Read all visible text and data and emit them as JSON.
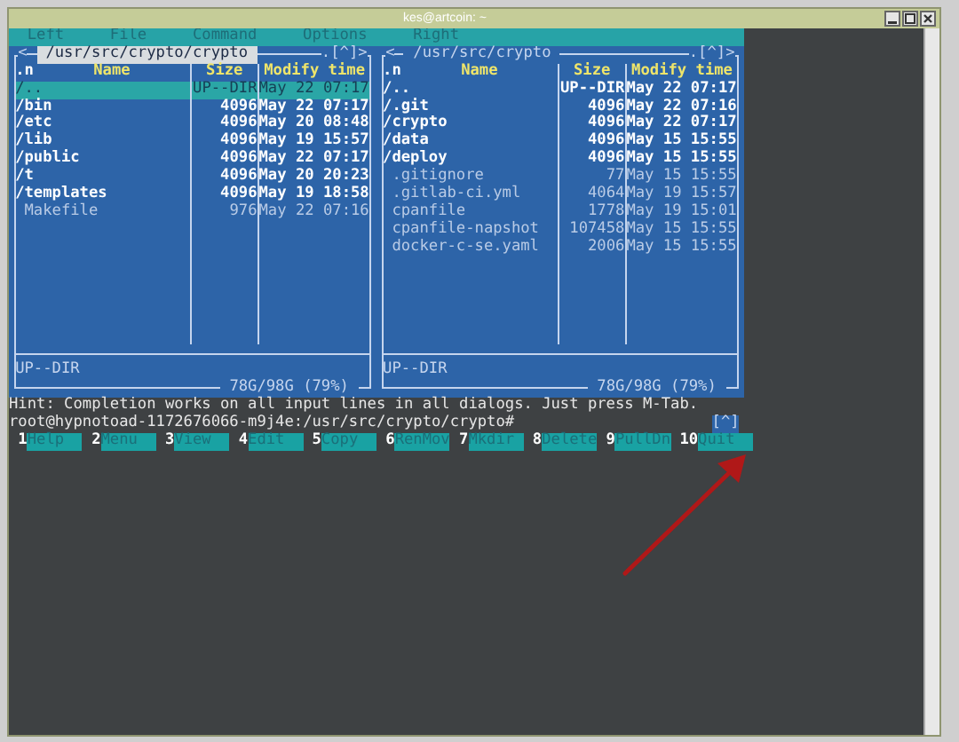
{
  "window": {
    "title": "kes@artcoin: ~"
  },
  "menu": [
    {
      "label": "Left"
    },
    {
      "label": "File"
    },
    {
      "label": "Command"
    },
    {
      "label": "Options"
    },
    {
      "label": "Right"
    }
  ],
  "panels": [
    {
      "active": true,
      "history": "<",
      "path": "/usr/src/crypto/crypto",
      "controls": ".[^]>",
      "columns": {
        "sort": ".n",
        "name": "Name",
        "size": "Size",
        "modified": "Modify time"
      },
      "rows": [
        {
          "name": "/..",
          "size": "UP--DIR",
          "modified": "May 22 07:17",
          "kind": "dir",
          "selected": true
        },
        {
          "name": "/bin",
          "size": "4096",
          "modified": "May 22 07:17",
          "kind": "dir",
          "selected": false
        },
        {
          "name": "/etc",
          "size": "4096",
          "modified": "May 20 08:48",
          "kind": "dir",
          "selected": false
        },
        {
          "name": "/lib",
          "size": "4096",
          "modified": "May 19 15:57",
          "kind": "dir",
          "selected": false
        },
        {
          "name": "/public",
          "size": "4096",
          "modified": "May 22 07:17",
          "kind": "dir",
          "selected": false
        },
        {
          "name": "/t",
          "size": "4096",
          "modified": "May 20 20:23",
          "kind": "dir",
          "selected": false
        },
        {
          "name": "/templates",
          "size": "4096",
          "modified": "May 19 18:58",
          "kind": "dir",
          "selected": false
        },
        {
          "name": "Makefile",
          "size": "976",
          "modified": "May 22 07:16",
          "kind": "file",
          "selected": false
        }
      ],
      "status": "UP--DIR",
      "disk": "78G/98G (79%)"
    },
    {
      "active": false,
      "history": "<",
      "path": "/usr/src/crypto",
      "controls": ".[^]>",
      "columns": {
        "sort": ".n",
        "name": "Name",
        "size": "Size",
        "modified": "Modify time"
      },
      "rows": [
        {
          "name": "/..",
          "size": "UP--DIR",
          "modified": "May 22 07:17",
          "kind": "dir",
          "selected": false
        },
        {
          "name": "/.git",
          "size": "4096",
          "modified": "May 22 07:16",
          "kind": "dir",
          "selected": false
        },
        {
          "name": "/crypto",
          "size": "4096",
          "modified": "May 22 07:17",
          "kind": "dir",
          "selected": false
        },
        {
          "name": "/data",
          "size": "4096",
          "modified": "May 15 15:55",
          "kind": "dir",
          "selected": false
        },
        {
          "name": "/deploy",
          "size": "4096",
          "modified": "May 15 15:55",
          "kind": "dir",
          "selected": false
        },
        {
          "name": ".gitignore",
          "size": "77",
          "modified": "May 15 15:55",
          "kind": "file",
          "selected": false
        },
        {
          "name": ".gitlab-ci.yml",
          "size": "4064",
          "modified": "May 19 15:57",
          "kind": "file",
          "selected": false
        },
        {
          "name": "cpanfile",
          "size": "1778",
          "modified": "May 19 15:01",
          "kind": "file",
          "selected": false
        },
        {
          "name": "cpanfile-napshot",
          "size": "107458",
          "modified": "May 15 15:55",
          "kind": "file",
          "selected": false
        },
        {
          "name": "docker-c-se.yaml",
          "size": "2006",
          "modified": "May 15 15:55",
          "kind": "file",
          "selected": false
        }
      ],
      "status": "UP--DIR",
      "disk": "78G/98G (79%)"
    }
  ],
  "hint": "Hint: Completion works on all input lines in all dialogs. Just press M-Tab.",
  "prompt": "root@hypnotoad-1172676066-m9j4e:/usr/src/crypto/crypto#",
  "history_button": "[^]",
  "function_keys": [
    {
      "number": "1",
      "label": "Help"
    },
    {
      "number": "2",
      "label": "Menu"
    },
    {
      "number": "3",
      "label": "View"
    },
    {
      "number": "4",
      "label": "Edit"
    },
    {
      "number": "5",
      "label": "Copy"
    },
    {
      "number": "6",
      "label": "RenMov"
    },
    {
      "number": "7",
      "label": "Mkdir"
    },
    {
      "number": "8",
      "label": "Delete"
    },
    {
      "number": "9",
      "label": "PullDn"
    },
    {
      "number": "10",
      "label": "Quit"
    }
  ]
}
